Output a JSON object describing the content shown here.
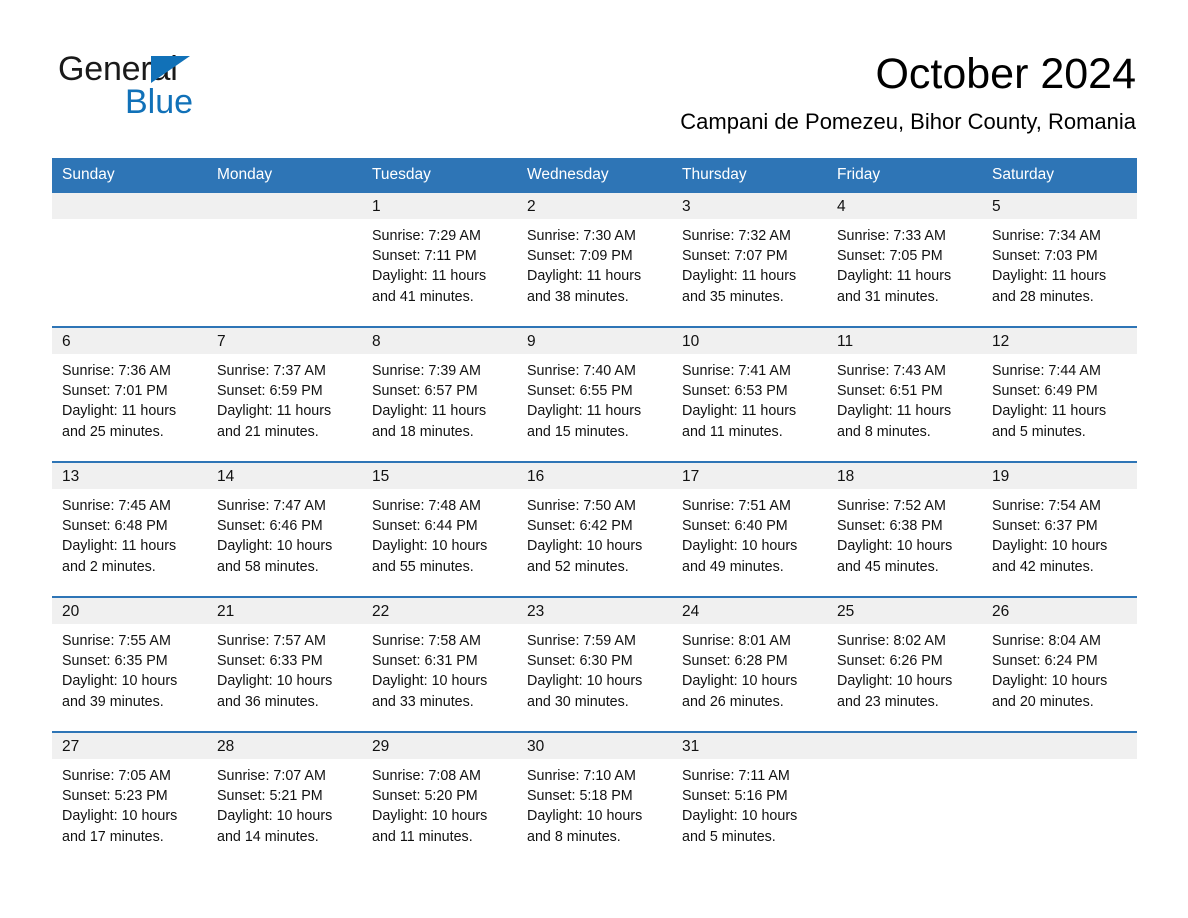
{
  "brand": {
    "name_part1": "General",
    "name_part2": "Blue",
    "triangle_color": "#1171b8"
  },
  "header": {
    "month_title": "October 2024",
    "location": "Campani de Pomezeu, Bihor County, Romania"
  },
  "colors": {
    "header_blue": "#2e75b6",
    "date_band_gray": "#f0f0f0",
    "text": "#111111",
    "header_text": "#ffffff"
  },
  "calendar": {
    "day_headers": [
      "Sunday",
      "Monday",
      "Tuesday",
      "Wednesday",
      "Thursday",
      "Friday",
      "Saturday"
    ],
    "weeks": [
      [
        {
          "day": ""
        },
        {
          "day": ""
        },
        {
          "day": "1",
          "sunrise": "Sunrise: 7:29 AM",
          "sunset": "Sunset: 7:11 PM",
          "daylight_line1": "Daylight: 11 hours",
          "daylight_line2": "and 41 minutes."
        },
        {
          "day": "2",
          "sunrise": "Sunrise: 7:30 AM",
          "sunset": "Sunset: 7:09 PM",
          "daylight_line1": "Daylight: 11 hours",
          "daylight_line2": "and 38 minutes."
        },
        {
          "day": "3",
          "sunrise": "Sunrise: 7:32 AM",
          "sunset": "Sunset: 7:07 PM",
          "daylight_line1": "Daylight: 11 hours",
          "daylight_line2": "and 35 minutes."
        },
        {
          "day": "4",
          "sunrise": "Sunrise: 7:33 AM",
          "sunset": "Sunset: 7:05 PM",
          "daylight_line1": "Daylight: 11 hours",
          "daylight_line2": "and 31 minutes."
        },
        {
          "day": "5",
          "sunrise": "Sunrise: 7:34 AM",
          "sunset": "Sunset: 7:03 PM",
          "daylight_line1": "Daylight: 11 hours",
          "daylight_line2": "and 28 minutes."
        }
      ],
      [
        {
          "day": "6",
          "sunrise": "Sunrise: 7:36 AM",
          "sunset": "Sunset: 7:01 PM",
          "daylight_line1": "Daylight: 11 hours",
          "daylight_line2": "and 25 minutes."
        },
        {
          "day": "7",
          "sunrise": "Sunrise: 7:37 AM",
          "sunset": "Sunset: 6:59 PM",
          "daylight_line1": "Daylight: 11 hours",
          "daylight_line2": "and 21 minutes."
        },
        {
          "day": "8",
          "sunrise": "Sunrise: 7:39 AM",
          "sunset": "Sunset: 6:57 PM",
          "daylight_line1": "Daylight: 11 hours",
          "daylight_line2": "and 18 minutes."
        },
        {
          "day": "9",
          "sunrise": "Sunrise: 7:40 AM",
          "sunset": "Sunset: 6:55 PM",
          "daylight_line1": "Daylight: 11 hours",
          "daylight_line2": "and 15 minutes."
        },
        {
          "day": "10",
          "sunrise": "Sunrise: 7:41 AM",
          "sunset": "Sunset: 6:53 PM",
          "daylight_line1": "Daylight: 11 hours",
          "daylight_line2": "and 11 minutes."
        },
        {
          "day": "11",
          "sunrise": "Sunrise: 7:43 AM",
          "sunset": "Sunset: 6:51 PM",
          "daylight_line1": "Daylight: 11 hours",
          "daylight_line2": "and 8 minutes."
        },
        {
          "day": "12",
          "sunrise": "Sunrise: 7:44 AM",
          "sunset": "Sunset: 6:49 PM",
          "daylight_line1": "Daylight: 11 hours",
          "daylight_line2": "and 5 minutes."
        }
      ],
      [
        {
          "day": "13",
          "sunrise": "Sunrise: 7:45 AM",
          "sunset": "Sunset: 6:48 PM",
          "daylight_line1": "Daylight: 11 hours",
          "daylight_line2": "and 2 minutes."
        },
        {
          "day": "14",
          "sunrise": "Sunrise: 7:47 AM",
          "sunset": "Sunset: 6:46 PM",
          "daylight_line1": "Daylight: 10 hours",
          "daylight_line2": "and 58 minutes."
        },
        {
          "day": "15",
          "sunrise": "Sunrise: 7:48 AM",
          "sunset": "Sunset: 6:44 PM",
          "daylight_line1": "Daylight: 10 hours",
          "daylight_line2": "and 55 minutes."
        },
        {
          "day": "16",
          "sunrise": "Sunrise: 7:50 AM",
          "sunset": "Sunset: 6:42 PM",
          "daylight_line1": "Daylight: 10 hours",
          "daylight_line2": "and 52 minutes."
        },
        {
          "day": "17",
          "sunrise": "Sunrise: 7:51 AM",
          "sunset": "Sunset: 6:40 PM",
          "daylight_line1": "Daylight: 10 hours",
          "daylight_line2": "and 49 minutes."
        },
        {
          "day": "18",
          "sunrise": "Sunrise: 7:52 AM",
          "sunset": "Sunset: 6:38 PM",
          "daylight_line1": "Daylight: 10 hours",
          "daylight_line2": "and 45 minutes."
        },
        {
          "day": "19",
          "sunrise": "Sunrise: 7:54 AM",
          "sunset": "Sunset: 6:37 PM",
          "daylight_line1": "Daylight: 10 hours",
          "daylight_line2": "and 42 minutes."
        }
      ],
      [
        {
          "day": "20",
          "sunrise": "Sunrise: 7:55 AM",
          "sunset": "Sunset: 6:35 PM",
          "daylight_line1": "Daylight: 10 hours",
          "daylight_line2": "and 39 minutes."
        },
        {
          "day": "21",
          "sunrise": "Sunrise: 7:57 AM",
          "sunset": "Sunset: 6:33 PM",
          "daylight_line1": "Daylight: 10 hours",
          "daylight_line2": "and 36 minutes."
        },
        {
          "day": "22",
          "sunrise": "Sunrise: 7:58 AM",
          "sunset": "Sunset: 6:31 PM",
          "daylight_line1": "Daylight: 10 hours",
          "daylight_line2": "and 33 minutes."
        },
        {
          "day": "23",
          "sunrise": "Sunrise: 7:59 AM",
          "sunset": "Sunset: 6:30 PM",
          "daylight_line1": "Daylight: 10 hours",
          "daylight_line2": "and 30 minutes."
        },
        {
          "day": "24",
          "sunrise": "Sunrise: 8:01 AM",
          "sunset": "Sunset: 6:28 PM",
          "daylight_line1": "Daylight: 10 hours",
          "daylight_line2": "and 26 minutes."
        },
        {
          "day": "25",
          "sunrise": "Sunrise: 8:02 AM",
          "sunset": "Sunset: 6:26 PM",
          "daylight_line1": "Daylight: 10 hours",
          "daylight_line2": "and 23 minutes."
        },
        {
          "day": "26",
          "sunrise": "Sunrise: 8:04 AM",
          "sunset": "Sunset: 6:24 PM",
          "daylight_line1": "Daylight: 10 hours",
          "daylight_line2": "and 20 minutes."
        }
      ],
      [
        {
          "day": "27",
          "sunrise": "Sunrise: 7:05 AM",
          "sunset": "Sunset: 5:23 PM",
          "daylight_line1": "Daylight: 10 hours",
          "daylight_line2": "and 17 minutes."
        },
        {
          "day": "28",
          "sunrise": "Sunrise: 7:07 AM",
          "sunset": "Sunset: 5:21 PM",
          "daylight_line1": "Daylight: 10 hours",
          "daylight_line2": "and 14 minutes."
        },
        {
          "day": "29",
          "sunrise": "Sunrise: 7:08 AM",
          "sunset": "Sunset: 5:20 PM",
          "daylight_line1": "Daylight: 10 hours",
          "daylight_line2": "and 11 minutes."
        },
        {
          "day": "30",
          "sunrise": "Sunrise: 7:10 AM",
          "sunset": "Sunset: 5:18 PM",
          "daylight_line1": "Daylight: 10 hours",
          "daylight_line2": "and 8 minutes."
        },
        {
          "day": "31",
          "sunrise": "Sunrise: 7:11 AM",
          "sunset": "Sunset: 5:16 PM",
          "daylight_line1": "Daylight: 10 hours",
          "daylight_line2": "and 5 minutes."
        },
        {
          "day": ""
        },
        {
          "day": ""
        }
      ]
    ]
  }
}
